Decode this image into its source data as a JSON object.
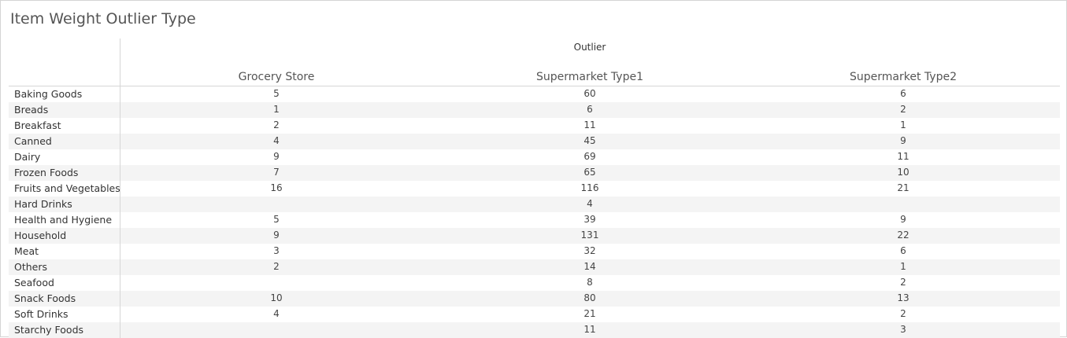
{
  "title": "Item Weight Outlier Type",
  "column_group_label": "Outlier",
  "chart_data": {
    "type": "table",
    "title": "Item Weight Outlier Type",
    "column_group": "Outlier",
    "columns": [
      "Grocery Store",
      "Supermarket Type1",
      "Supermarket Type2"
    ],
    "rows": [
      {
        "label": "Baking Goods",
        "values": [
          5,
          60,
          6
        ]
      },
      {
        "label": "Breads",
        "values": [
          1,
          6,
          2
        ]
      },
      {
        "label": "Breakfast",
        "values": [
          2,
          11,
          1
        ]
      },
      {
        "label": "Canned",
        "values": [
          4,
          45,
          9
        ]
      },
      {
        "label": "Dairy",
        "values": [
          9,
          69,
          11
        ]
      },
      {
        "label": "Frozen Foods",
        "values": [
          7,
          65,
          10
        ]
      },
      {
        "label": "Fruits and Vegetables",
        "values": [
          16,
          116,
          21
        ]
      },
      {
        "label": "Hard Drinks",
        "values": [
          null,
          4,
          null
        ]
      },
      {
        "label": "Health and Hygiene",
        "values": [
          5,
          39,
          9
        ]
      },
      {
        "label": "Household",
        "values": [
          9,
          131,
          22
        ]
      },
      {
        "label": "Meat",
        "values": [
          3,
          32,
          6
        ]
      },
      {
        "label": "Others",
        "values": [
          2,
          14,
          1
        ]
      },
      {
        "label": "Seafood",
        "values": [
          null,
          8,
          2
        ]
      },
      {
        "label": "Snack Foods",
        "values": [
          10,
          80,
          13
        ]
      },
      {
        "label": "Soft Drinks",
        "values": [
          4,
          21,
          2
        ]
      },
      {
        "label": "Starchy Foods",
        "values": [
          null,
          11,
          3
        ]
      }
    ]
  }
}
